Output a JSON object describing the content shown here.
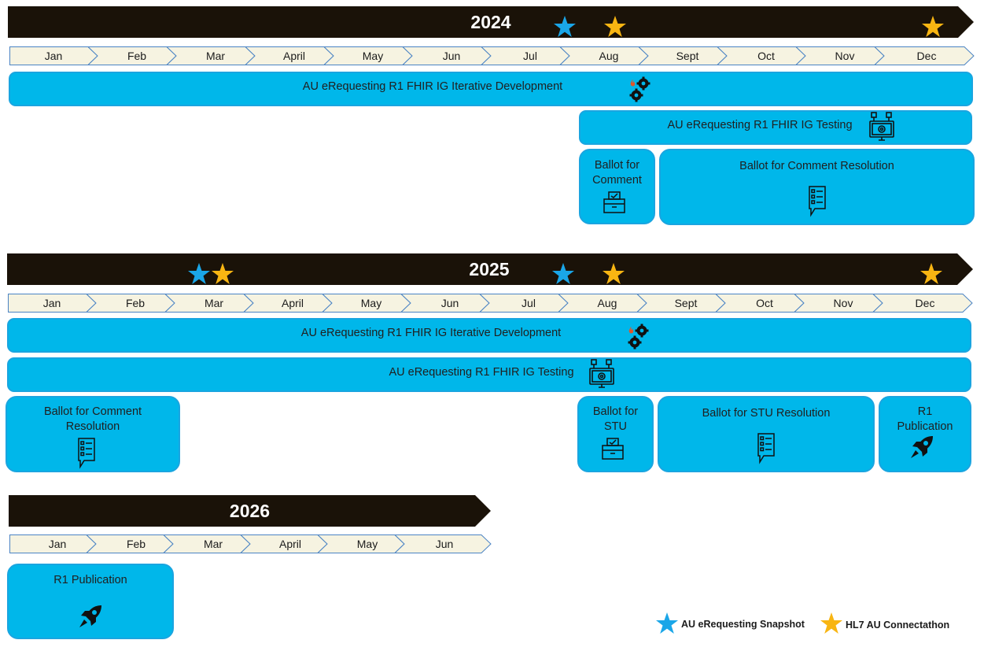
{
  "colors": {
    "timeline_bar": "#1a1208",
    "month_fill": "#f6f3e1",
    "month_stroke": "#4a83c4",
    "block_fill": "#00b7ea",
    "snapshot_star": "#1aa6e8",
    "connectathon_star": "#f8b512"
  },
  "years": [
    {
      "label": "2024",
      "months": [
        "Jan",
        "Feb",
        "Mar",
        "April",
        "May",
        "Jun",
        "Jul",
        "Aug",
        "Sept",
        "Oct",
        "Nov",
        "Dec"
      ],
      "blocks": [
        {
          "label": "AU eRequesting R1 FHIR IG Iterative Development",
          "icon": "gears-icon"
        },
        {
          "label": "AU eRequesting R1 FHIR IG Testing",
          "icon": "monitor-settings-icon"
        },
        {
          "label": "Ballot for Comment",
          "icon": "ballot-box-icon"
        },
        {
          "label": "Ballot for Comment Resolution",
          "icon": "checklist-document-icon"
        }
      ]
    },
    {
      "label": "2025",
      "months": [
        "Jan",
        "Feb",
        "Mar",
        "April",
        "May",
        "Jun",
        "Jul",
        "Aug",
        "Sept",
        "Oct",
        "Nov",
        "Dec"
      ],
      "blocks": [
        {
          "label": "AU eRequesting R1 FHIR IG Iterative Development",
          "icon": "gears-icon"
        },
        {
          "label": "AU eRequesting R1 FHIR IG Testing",
          "icon": "monitor-settings-icon"
        },
        {
          "label": "Ballot for Comment Resolution",
          "icon": "checklist-document-icon"
        },
        {
          "label": "Ballot for STU",
          "icon": "ballot-box-icon"
        },
        {
          "label": "Ballot for STU Resolution",
          "icon": "checklist-document-icon"
        },
        {
          "label": "R1 Publication",
          "icon": "rocket-icon"
        }
      ]
    },
    {
      "label": "2026",
      "months": [
        "Jan",
        "Feb",
        "Mar",
        "April",
        "May",
        "Jun"
      ],
      "blocks": [
        {
          "label": "R1 Publication",
          "icon": "rocket-icon"
        }
      ]
    }
  ],
  "legend": {
    "snapshot": "AU eRequesting Snapshot",
    "connectathon": "HL7 AU Connectathon"
  }
}
